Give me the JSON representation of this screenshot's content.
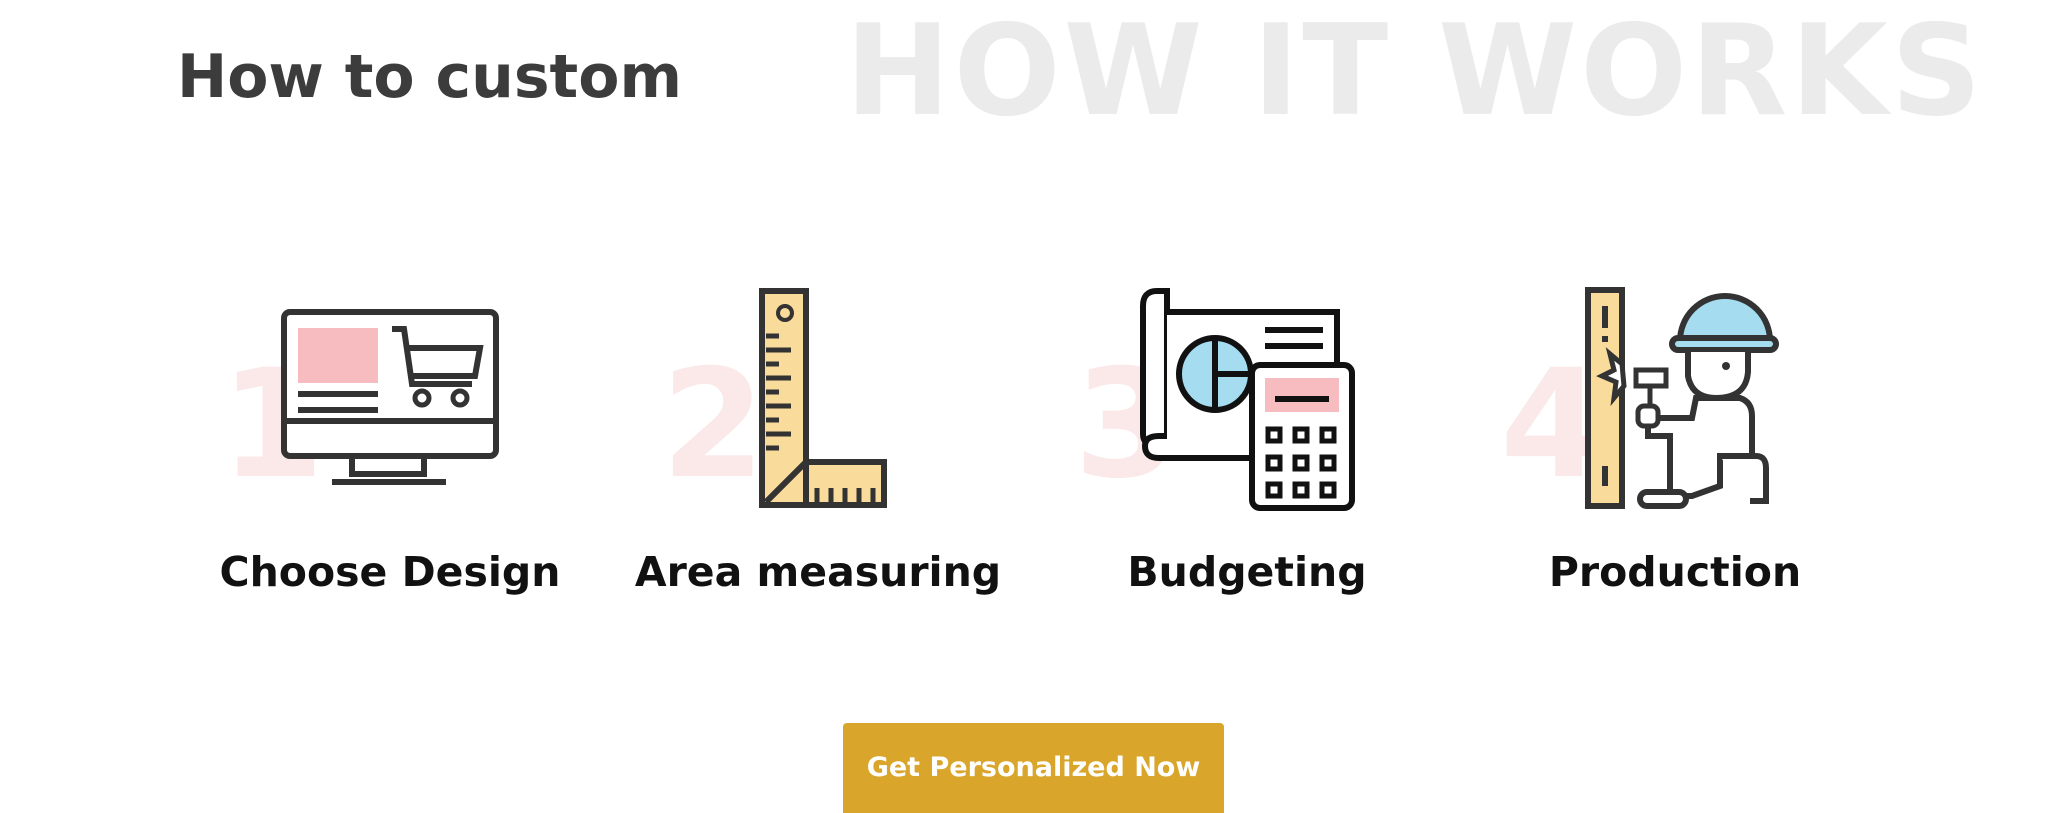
{
  "section": {
    "background_title": "HOW IT WORKS",
    "heading": "How to custom"
  },
  "steps": [
    {
      "number": "1",
      "label": "Choose Design",
      "icon": "monitor-cart-icon"
    },
    {
      "number": "2",
      "label": "Area measuring",
      "icon": "set-square-ruler-icon"
    },
    {
      "number": "3",
      "label": "Budgeting",
      "icon": "blueprint-calculator-icon"
    },
    {
      "number": "4",
      "label": "Production",
      "icon": "worker-hammer-icon"
    }
  ],
  "cta": {
    "label": "Get Personalized Now"
  },
  "colors": {
    "accent": "#d9a52a",
    "watermark": "#ebebeb",
    "step_number": "#fbe9ea",
    "icon_pink": "#f7bcbf",
    "icon_yellow": "#f9dc9b",
    "icon_blue": "#a6dcef",
    "icon_stroke": "#333333"
  }
}
